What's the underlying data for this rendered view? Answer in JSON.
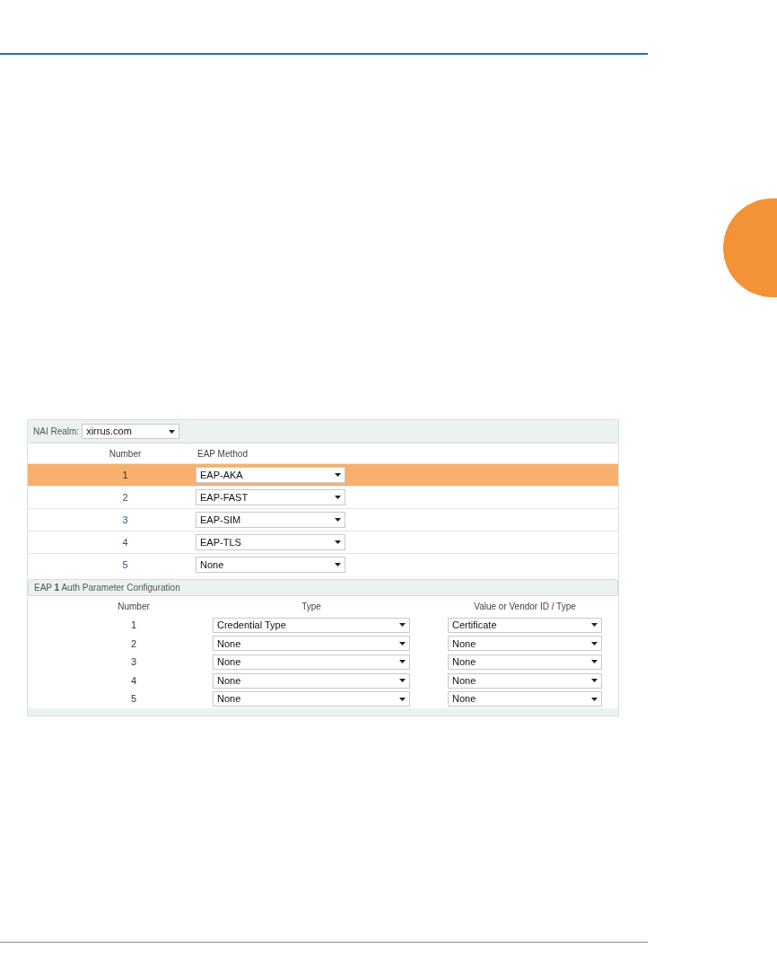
{
  "nai_realm": {
    "label": "NAI Realm:",
    "value": "xirrus.com"
  },
  "eap_table": {
    "columns": [
      "Number",
      "EAP Method"
    ],
    "rows": [
      {
        "number": "1",
        "method": "EAP-AKA",
        "selected": true
      },
      {
        "number": "2",
        "method": "EAP-FAST",
        "selected": false
      },
      {
        "number": "3",
        "method": "EAP-SIM",
        "selected": false
      },
      {
        "number": "4",
        "method": "EAP-TLS",
        "selected": false
      },
      {
        "number": "5",
        "method": "None",
        "selected": false
      }
    ]
  },
  "auth_section": {
    "title": "EAP **1** Auth Parameter Configuration",
    "columns": [
      "Number",
      "Type",
      "Value or Vendor ID / Type"
    ],
    "rows": [
      {
        "number": "1",
        "type": "Credential Type",
        "value": "Certificate"
      },
      {
        "number": "2",
        "type": "None",
        "value": "None"
      },
      {
        "number": "3",
        "type": "None",
        "value": "None"
      },
      {
        "number": "4",
        "type": "None",
        "value": "None"
      },
      {
        "number": "5",
        "type": "None",
        "value": "None"
      }
    ]
  }
}
